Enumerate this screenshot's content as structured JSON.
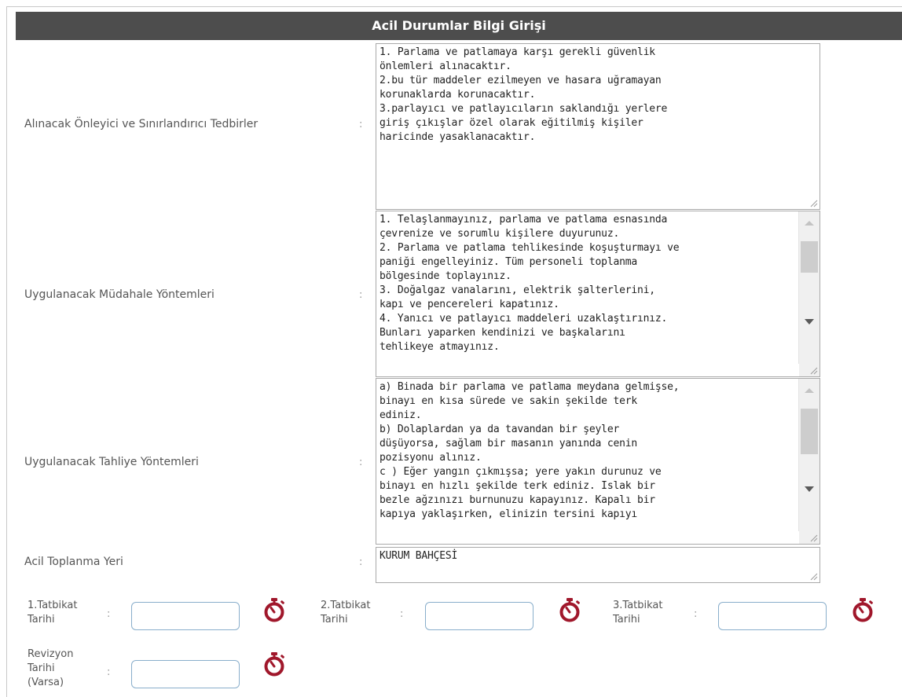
{
  "form": {
    "title": "Acil Durumlar Bilgi Girişi",
    "colon": ":",
    "fields": [
      {
        "label": "Alınacak Önleyici ve Sınırlandırıcı Tedbirler",
        "value": "1. Parlama ve patlamaya karşı gerekli güvenlik\nönlemleri alınacaktır.\n2.bu tür maddeler ezilmeyen ve hasara uğramayan\nkorunaklarda korunacaktır.\n3.parlayıcı ve patlayıcıların saklandığı yerlere\ngiriş çıkışlar özel olarak eğitilmiş kişiler\nharicinde yasaklanacaktır."
      },
      {
        "label": "Uygulanacak Müdahale Yöntemleri",
        "value": "1. Telaşlanmayınız, parlama ve patlama esnasında\nçevrenize ve sorumlu kişilere duyurunuz.\n2. Parlama ve patlama tehlikesinde koşuşturmayı ve\npaniği engelleyiniz. Tüm personeli toplanma\nbölgesinde toplayınız.\n3. Doğalgaz vanalarını, elektrik şalterlerini,\nkapı ve pencereleri kapatınız.\n4. Yanıcı ve patlayıcı maddeleri uzaklaştırınız.\nBunları yaparken kendinizi ve başkalarını\ntehlikeye atmayınız."
      },
      {
        "label": "Uygulanacak Tahliye Yöntemleri",
        "value": "a) Binada bir parlama ve patlama meydana gelmişse,\nbinayı en kısa sürede ve sakin şekilde terk\nediniz.\nb) Dolaplardan ya da tavandan bir şeyler\ndüşüyorsa, sağlam bir masanın yanında cenin\npozisyonu alınız.\nc ) Eğer yangın çıkmışsa; yere yakın durunuz ve\nbinayı en hızlı şekilde terk ediniz. Islak bir\nbezle ağzınızı burnunuzu kapayınız. Kapalı bir\nkapıya yaklaşırken, elinizin tersini kapıyı"
      },
      {
        "label": "Acil Toplanma Yeri",
        "value": "KURUM BAHÇESİ"
      }
    ],
    "dates": [
      {
        "label_line1": "1.Tatbikat",
        "label_line2": "Tarihi",
        "value": ""
      },
      {
        "label_line1": "2.Tatbikat",
        "label_line2": "Tarihi",
        "value": ""
      },
      {
        "label_line1": "3.Tatbikat",
        "label_line2": "Tarihi",
        "value": ""
      }
    ],
    "revision": {
      "label_line1": "Revizyon",
      "label_line2": "Tarihi",
      "label_line3": "(Varsa)",
      "value": ""
    }
  },
  "colors": {
    "header_bg": "#4d4d4d",
    "timer_icon": "#a0172b",
    "input_border": "#89aecb"
  },
  "icons": {
    "date_picker": "stopwatch-icon",
    "textarea_resize": "resize-grip-icon"
  }
}
